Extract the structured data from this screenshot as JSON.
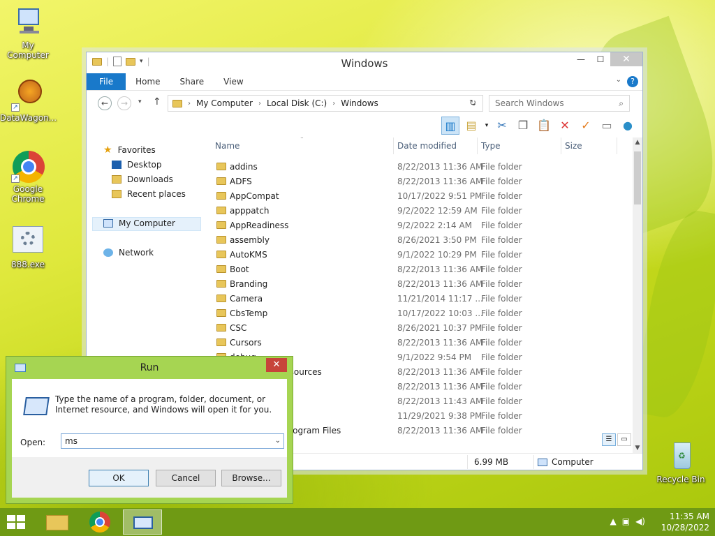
{
  "desktop": {
    "icons": [
      {
        "label": "My Computer"
      },
      {
        "label": "DataWagon..."
      },
      {
        "label": "Google Chrome"
      },
      {
        "label": "888.exe"
      },
      {
        "label": "Recycle Bin"
      }
    ]
  },
  "explorer": {
    "title": "Windows",
    "tabs": {
      "file": "File",
      "home": "Home",
      "share": "Share",
      "view": "View",
      "help": "?"
    },
    "address": {
      "root": "My Computer",
      "drive": "Local Disk (C:)",
      "folder": "Windows"
    },
    "search_placeholder": "Search Windows",
    "nav": {
      "favorites": "Favorites",
      "desktop": "Desktop",
      "downloads": "Downloads",
      "recent": "Recent places",
      "my_computer": "My Computer",
      "network": "Network"
    },
    "columns": {
      "name": "Name",
      "date": "Date modified",
      "type": "Type",
      "size": "Size"
    },
    "rows": [
      {
        "name": "addins",
        "date": "8/22/2013 11:36 AM",
        "type": "File folder"
      },
      {
        "name": "ADFS",
        "date": "8/22/2013 11:36 AM",
        "type": "File folder"
      },
      {
        "name": "AppCompat",
        "date": "10/17/2022 9:51 PM",
        "type": "File folder"
      },
      {
        "name": "apppatch",
        "date": "9/2/2022 12:59 AM",
        "type": "File folder"
      },
      {
        "name": "AppReadiness",
        "date": "9/2/2022 2:14 AM",
        "type": "File folder"
      },
      {
        "name": "assembly",
        "date": "8/26/2021 3:50 PM",
        "type": "File folder"
      },
      {
        "name": "AutoKMS",
        "date": "9/1/2022 10:29 PM",
        "type": "File folder"
      },
      {
        "name": "Boot",
        "date": "8/22/2013 11:36 AM",
        "type": "File folder"
      },
      {
        "name": "Branding",
        "date": "8/22/2013 11:36 AM",
        "type": "File folder"
      },
      {
        "name": "Camera",
        "date": "11/21/2014 11:17 ...",
        "type": "File folder"
      },
      {
        "name": "CbsTemp",
        "date": "10/17/2022 10:03 ...",
        "type": "File folder"
      },
      {
        "name": "CSC",
        "date": "8/26/2021 10:37 PM",
        "type": "File folder"
      },
      {
        "name": "Cursors",
        "date": "8/22/2013 11:36 AM",
        "type": "File folder"
      },
      {
        "name": "debug",
        "date": "9/1/2022 9:54 PM",
        "type": "File folder"
      },
      {
        "name": "DesktopTileResources",
        "date": "8/22/2013 11:36 AM",
        "type": "File folder"
      },
      {
        "name": "",
        "date": "8/22/2013 11:36 AM",
        "type": "File folder"
      },
      {
        "name": "",
        "date": "8/22/2013 11:43 AM",
        "type": "File folder"
      },
      {
        "name": "",
        "date": "11/29/2021 9:38 PM",
        "type": "File folder"
      },
      {
        "name": "Downloaded Program Files",
        "date": "8/22/2013 11:36 AM",
        "type": "File folder"
      }
    ],
    "status": {
      "size": "6.99 MB",
      "location": "Computer"
    }
  },
  "run": {
    "title": "Run",
    "message": "Type the name of a program, folder, document, or Internet resource, and Windows will open it for you.",
    "open_label": "Open:",
    "value": "ms",
    "ok": "OK",
    "cancel": "Cancel",
    "browse": "Browse..."
  },
  "taskbar": {
    "time": "11:35 AM",
    "date": "10/28/2022"
  }
}
